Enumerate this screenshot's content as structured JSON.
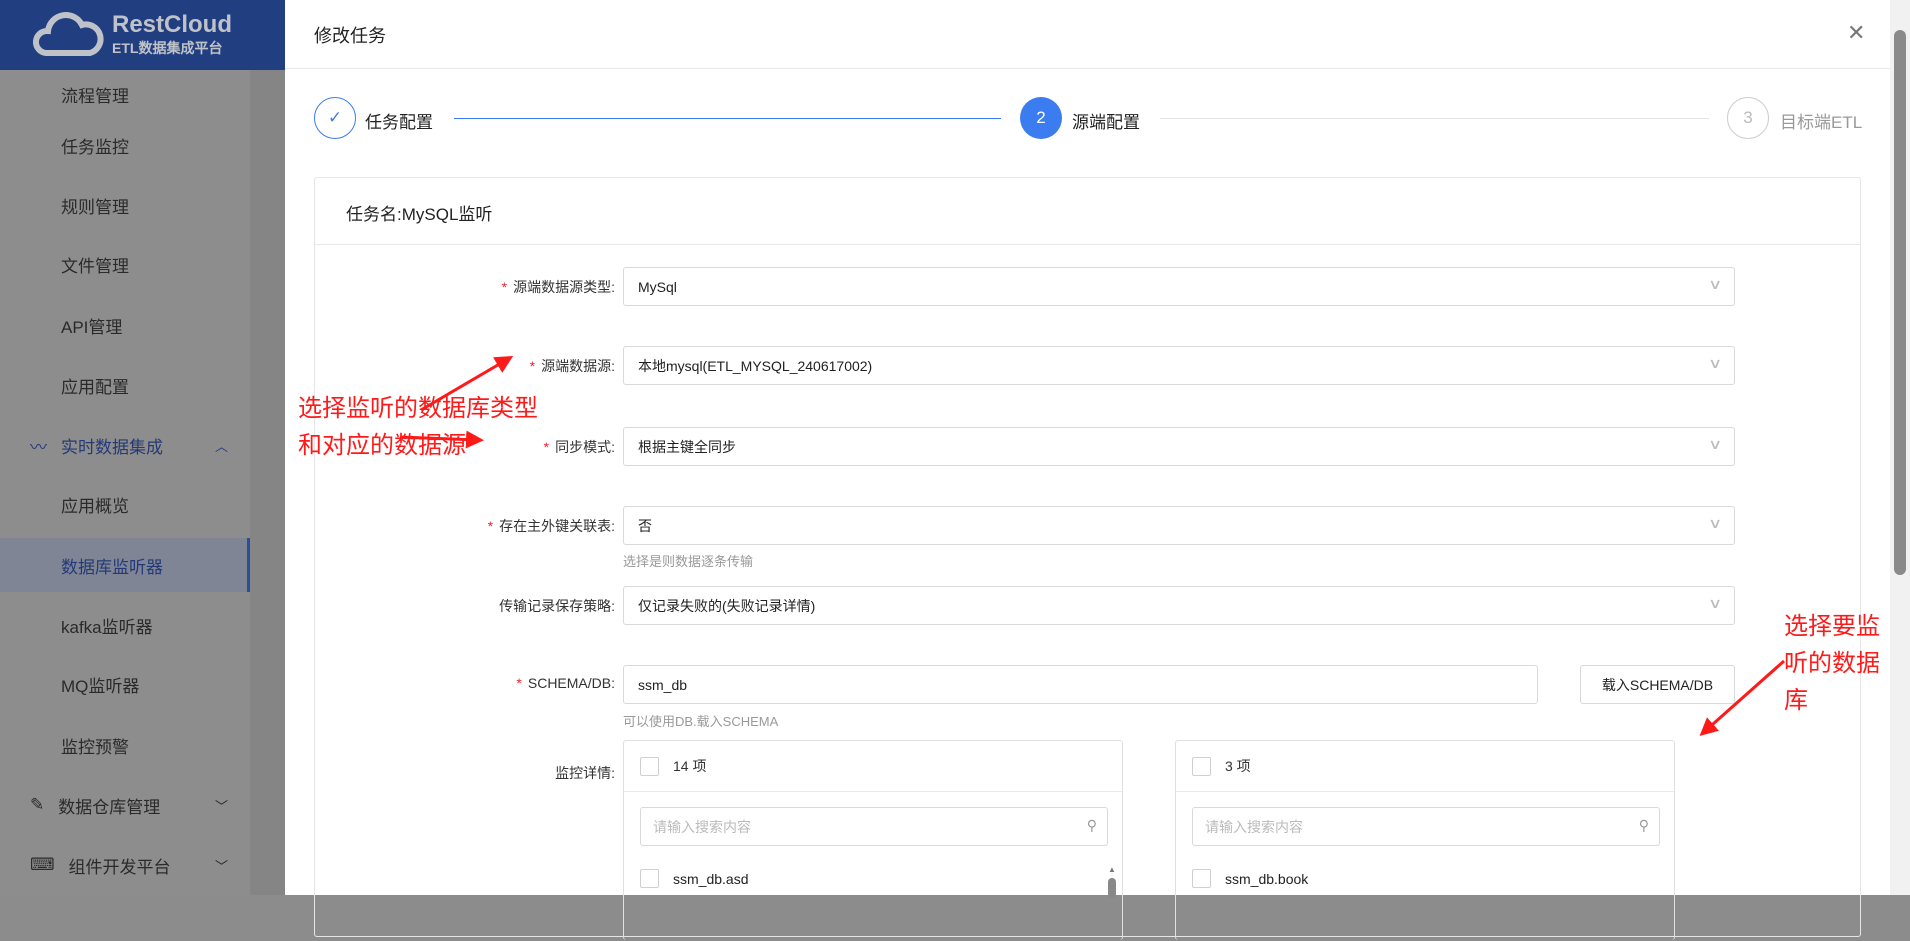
{
  "brand": {
    "name": "RestCloud",
    "subtitle": "ETL数据集成平台"
  },
  "sidebar": {
    "items": [
      {
        "label": "流程管理"
      },
      {
        "label": "任务监控"
      },
      {
        "label": "规则管理"
      },
      {
        "label": "文件管理"
      },
      {
        "label": "API管理"
      },
      {
        "label": "应用配置"
      },
      {
        "label": "实时数据集成",
        "icon": "pulse-icon",
        "expanded": true
      },
      {
        "label": "应用概览"
      },
      {
        "label": "数据库监听器",
        "selected": true
      },
      {
        "label": "kafka监听器"
      },
      {
        "label": "MQ监听器"
      },
      {
        "label": "监控预警"
      },
      {
        "label": "数据仓库管理",
        "icon": "edit-doc-icon"
      },
      {
        "label": "组件开发平台",
        "icon": "code-icon"
      }
    ]
  },
  "drawer": {
    "title": "修改任务",
    "steps": [
      {
        "num": "1",
        "label": "任务配置",
        "status": "done"
      },
      {
        "num": "2",
        "label": "源端配置",
        "status": "active"
      },
      {
        "num": "3",
        "label": "目标端ETL",
        "status": "wait"
      }
    ],
    "card_title": "任务名:MySQL监听",
    "form": [
      {
        "label": "源端数据源类型:",
        "required": true,
        "value": "MySql"
      },
      {
        "label": "源端数据源:",
        "required": true,
        "value": "本地mysql(ETL_MYSQL_240617002)"
      },
      {
        "label": "同步模式:",
        "required": true,
        "value": "根据主键全同步"
      },
      {
        "label": "存在主外键关联表:",
        "required": true,
        "value": "否",
        "help": "选择是则数据逐条传输"
      },
      {
        "label": "传输记录保存策略:",
        "required": false,
        "value": "仅记录失败的(失败记录详情)"
      },
      {
        "label": "SCHEMA/DB:",
        "required": true,
        "value": "ssm_db",
        "help": "可以使用DB.载入SCHEMA"
      }
    ],
    "load_button": "载入SCHEMA/DB",
    "monitor_label": "监控详情:",
    "transfer": {
      "left": {
        "count": "14 项",
        "placeholder": "请输入搜索内容",
        "items": [
          "ssm_db.asd"
        ]
      },
      "right": {
        "count": "3 项",
        "placeholder": "请输入搜索内容",
        "items": [
          "ssm_db.book"
        ]
      }
    }
  },
  "annotations": {
    "left_line1": "选择监听的数据库类型",
    "left_line2": "和对应的数据源",
    "right_line1": "选择要监",
    "right_line2": "听的数据",
    "right_line3": "库"
  },
  "colors": {
    "primary": "#3b7cf0",
    "brand": "#213f80",
    "annotation": "#ff1a1a"
  }
}
